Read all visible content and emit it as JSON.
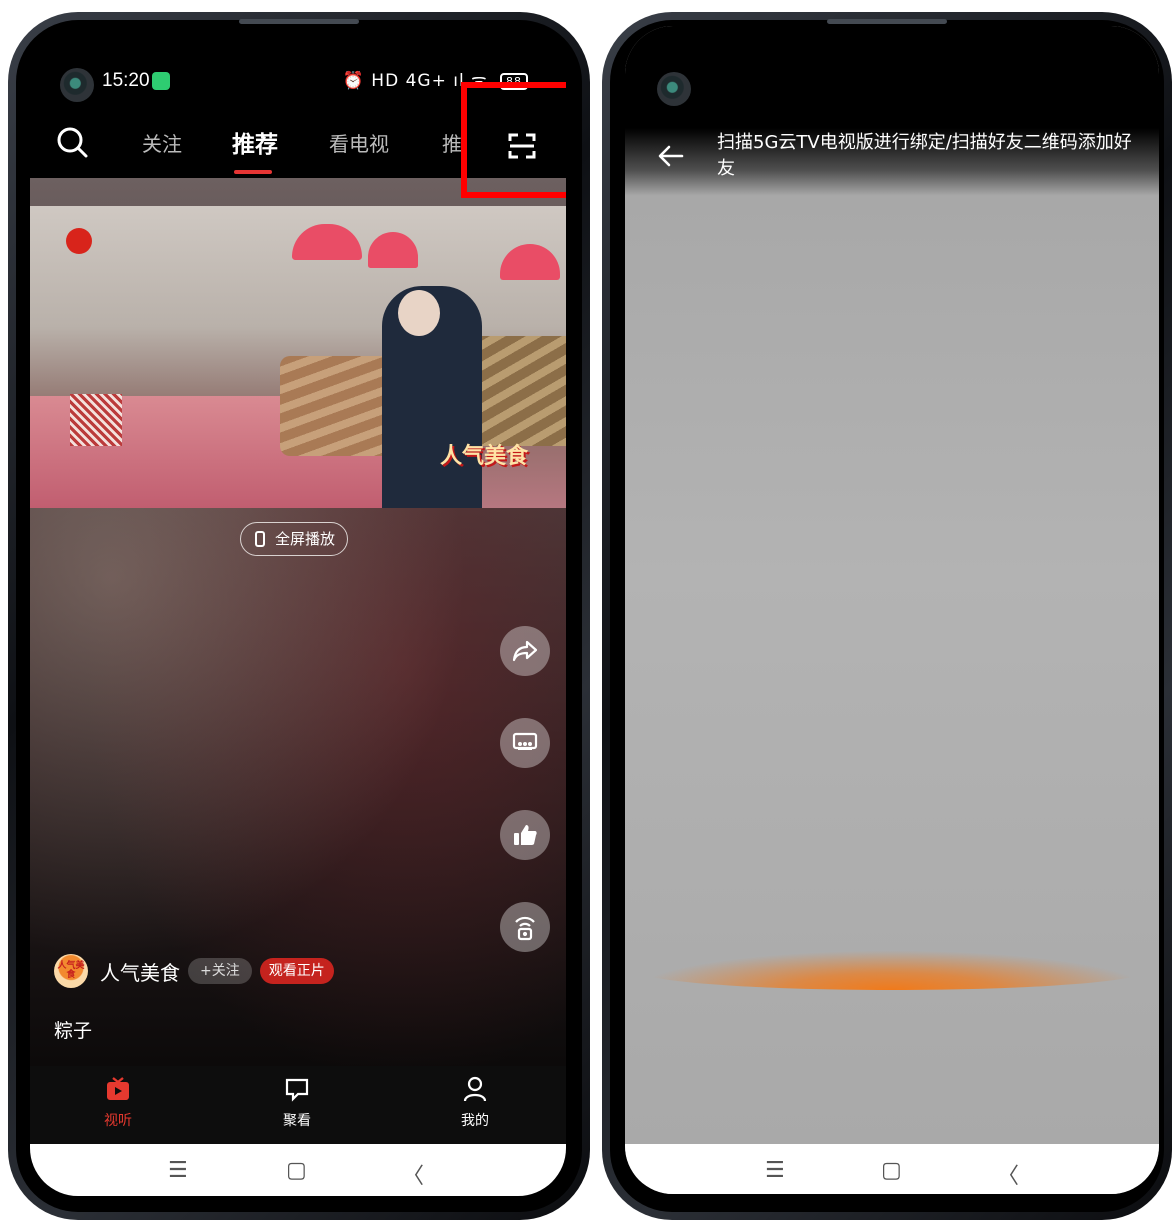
{
  "left_phone": {
    "status": {
      "time": "15:20",
      "icons": "⏰ HD 4G+ ıl ᯤ",
      "battery": "88"
    },
    "topnav": {
      "tabs": [
        {
          "label": "关注"
        },
        {
          "label": "推荐"
        },
        {
          "label": "看电视"
        },
        {
          "label": "推"
        }
      ],
      "active_tab": "推荐"
    },
    "video": {
      "overlay_text": "人气美食"
    },
    "fullscreen_label": "全屏播放",
    "author": {
      "avatar_text": "人气美食",
      "name": "人气美食",
      "follow_label": "+关注",
      "watch_label": "观看正片"
    },
    "caption": "粽子",
    "bottom_nav": [
      {
        "label": "视听",
        "icon": "tv-icon",
        "active": true
      },
      {
        "label": "聚看",
        "icon": "chat-icon",
        "active": false
      },
      {
        "label": "我的",
        "icon": "user-icon",
        "active": false
      }
    ],
    "system_nav": {
      "menu": "☰",
      "home": "▢",
      "back": "〈"
    }
  },
  "right_phone": {
    "scan_title": "扫描5G云TV电视版进行绑定/扫描好友二维码添加好友",
    "system_nav": {
      "menu": "☰",
      "home": "▢",
      "back": "〈"
    }
  },
  "colors": {
    "accent_red": "#e63534",
    "highlight_box": "#ff0000",
    "scan_line": "#f07a1b"
  }
}
